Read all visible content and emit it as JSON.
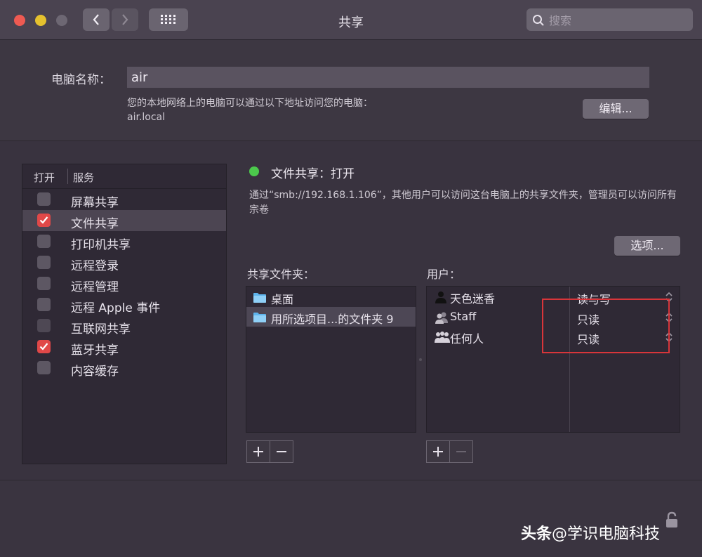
{
  "window": {
    "title": "共享"
  },
  "search": {
    "placeholder": "搜索"
  },
  "computer_name": {
    "label": "电脑名称：",
    "value": "air",
    "description": "您的本地网络上的电脑可以通过以下地址访问您的电脑：",
    "address": "air.local",
    "edit_label": "编辑..."
  },
  "services": {
    "header_on": "打开",
    "header_service": "服务",
    "items": [
      {
        "label": "屏幕共享",
        "checked": false
      },
      {
        "label": "文件共享",
        "checked": true
      },
      {
        "label": "打印机共享",
        "checked": false
      },
      {
        "label": "远程登录",
        "checked": false
      },
      {
        "label": "远程管理",
        "checked": false
      },
      {
        "label": "远程 Apple 事件",
        "checked": false
      },
      {
        "label": "互联网共享",
        "checked": false
      },
      {
        "label": "蓝牙共享",
        "checked": true
      },
      {
        "label": "内容缓存",
        "checked": false
      }
    ]
  },
  "detail": {
    "status_title": "文件共享：打开",
    "status_color": "#4cc94c",
    "description": "通过“smb://192.168.1.106”，其他用户可以访问这台电脑上的共享文件夹，管理员可以访问所有宗卷",
    "options_label": "选项...",
    "shared_folders_label": "共享文件夹：",
    "users_label": "用户：",
    "folders": [
      "桌面",
      "用所选项目...的文件夹 9"
    ],
    "users": [
      {
        "name": "天色迷香",
        "permission": "读与写",
        "icon": "single-user-icon"
      },
      {
        "name": "Staff",
        "permission": "只读",
        "icon": "group-icon"
      },
      {
        "name": "任何人",
        "permission": "只读",
        "icon": "everyone-icon"
      }
    ]
  },
  "watermark": {
    "brand": "头条",
    "text": "@学识电脑科技"
  },
  "colors": {
    "highlight_box": "#d8353a",
    "checkbox_on": "#e04848"
  }
}
